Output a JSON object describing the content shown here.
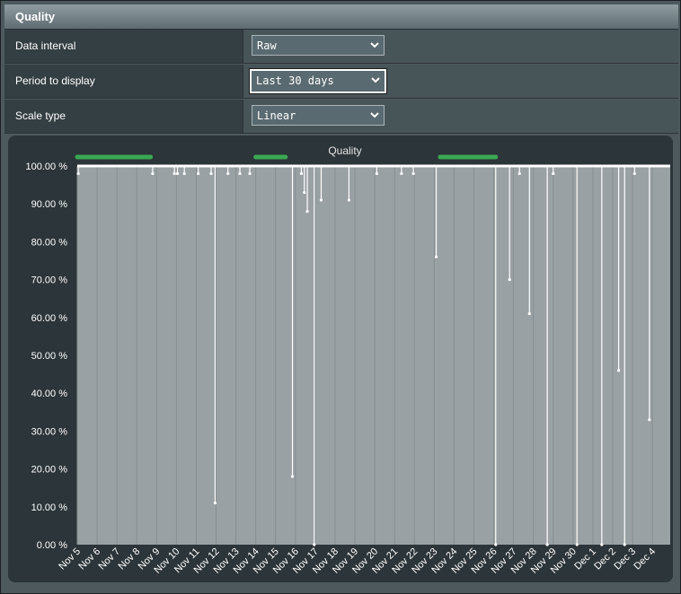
{
  "panel": {
    "title": "Quality"
  },
  "settings": [
    {
      "label": "Data interval",
      "value": "Raw"
    },
    {
      "label": "Period to display",
      "value": "Last 30 days"
    },
    {
      "label": "Scale type",
      "value": "Linear"
    }
  ],
  "colors": {
    "uptime_bar": "#3aa853",
    "plot_bg": "#9aa1a4",
    "line": "#ffffff"
  },
  "chart_data": {
    "type": "line",
    "title": "Quality",
    "ylim": [
      0,
      100
    ],
    "y_ticks": [
      "100.00 %",
      "90.00 %",
      "80.00 %",
      "70.00 %",
      "60.00 %",
      "50.00 %",
      "40.00 %",
      "30.00 %",
      "20.00 %",
      "10.00 %",
      "0.00 %"
    ],
    "x_ticks": [
      "Nov 5",
      "Nov 6",
      "Nov 7",
      "Nov 8",
      "Nov 9",
      "Nov 10",
      "Nov 11",
      "Nov 12",
      "Nov 13",
      "Nov 14",
      "Nov 15",
      "Nov 16",
      "Nov 17",
      "Nov 18",
      "Nov 19",
      "Nov 20",
      "Nov 21",
      "Nov 22",
      "Nov 23",
      "Nov 24",
      "Nov 25",
      "Nov 26",
      "Nov 27",
      "Nov 28",
      "Nov 29",
      "Nov 30",
      "Dec 1",
      "Dec 2",
      "Dec 3",
      "Dec 4"
    ],
    "baseline": 100,
    "dips": [
      {
        "day": 0.05,
        "value": 98
      },
      {
        "day": 3.8,
        "value": 98
      },
      {
        "day": 4.9,
        "value": 98
      },
      {
        "day": 5.05,
        "value": 98
      },
      {
        "day": 5.4,
        "value": 98
      },
      {
        "day": 6.1,
        "value": 98
      },
      {
        "day": 6.75,
        "value": 98
      },
      {
        "day": 6.95,
        "value": 11
      },
      {
        "day": 7.6,
        "value": 98
      },
      {
        "day": 8.2,
        "value": 98
      },
      {
        "day": 8.7,
        "value": 98
      },
      {
        "day": 10.85,
        "value": 18
      },
      {
        "day": 11.3,
        "value": 98
      },
      {
        "day": 11.45,
        "value": 93
      },
      {
        "day": 11.6,
        "value": 88
      },
      {
        "day": 11.95,
        "value": 0
      },
      {
        "day": 12.3,
        "value": 91
      },
      {
        "day": 13.7,
        "value": 91
      },
      {
        "day": 15.1,
        "value": 98
      },
      {
        "day": 16.35,
        "value": 98
      },
      {
        "day": 16.95,
        "value": 98
      },
      {
        "day": 18.1,
        "value": 76
      },
      {
        "day": 21.1,
        "value": 0
      },
      {
        "day": 21.8,
        "value": 70
      },
      {
        "day": 22.3,
        "value": 98
      },
      {
        "day": 22.8,
        "value": 61
      },
      {
        "day": 23.7,
        "value": 0
      },
      {
        "day": 24.0,
        "value": 98
      },
      {
        "day": 25.2,
        "value": 0
      },
      {
        "day": 26.45,
        "value": 0
      },
      {
        "day": 27.3,
        "value": 46
      },
      {
        "day": 27.6,
        "value": 0
      },
      {
        "day": 28.1,
        "value": 98
      },
      {
        "day": 28.85,
        "value": 33
      }
    ],
    "uptime_segments": [
      {
        "start": 0,
        "end": 3.7
      },
      {
        "start": 9.0,
        "end": 10.5
      },
      {
        "start": 18.3,
        "end": 21.1
      }
    ]
  }
}
